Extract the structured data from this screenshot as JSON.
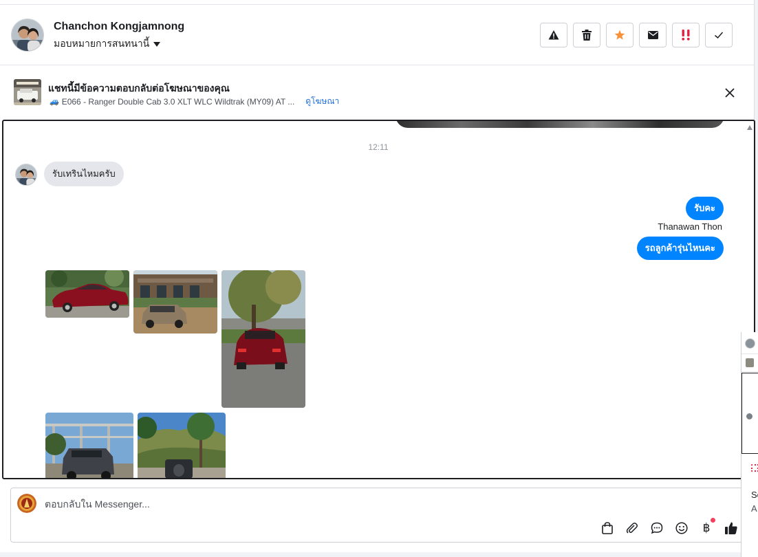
{
  "header": {
    "contact_name": "Chanchon Kongjamnong",
    "assign_label": "มอบหมายการสนทนานี้",
    "actions": [
      {
        "name": "report-spam-button",
        "icon": "warning-icon"
      },
      {
        "name": "delete-button",
        "icon": "trash-icon"
      },
      {
        "name": "star-button",
        "icon": "star-icon",
        "color": "#f7923b"
      },
      {
        "name": "mark-unread-button",
        "icon": "envelope-icon"
      },
      {
        "name": "follow-up-button",
        "icon": "exclamation-icon",
        "color": "#e41e3f"
      },
      {
        "name": "mark-done-button",
        "icon": "check-icon"
      }
    ]
  },
  "banner": {
    "title": "แชทนี้มีข้อความตอบกลับต่อโฆษณาของคุณ",
    "ad_text": "E066 - Ranger Double Cab 3.0 XLT WLC Wildtrak (MY09) AT ...",
    "ad_emoji": "🚙",
    "view_ad_link": "ดูโฆษณา"
  },
  "conversation": {
    "timestamp": "12:11",
    "incoming_message": "รับเทรินไหมครับ",
    "outgoing_1": "รับคะ",
    "sender_name": "Thanawan Thon",
    "outgoing_2": "รถลูกค้ารุ่นไหนคะ"
  },
  "composer": {
    "placeholder": "ตอบกลับใน Messenger...",
    "baht_symbol": "฿"
  },
  "side_window": {
    "text_1": "So",
    "text_2": "A"
  },
  "colors": {
    "accent": "#0084ff",
    "link": "#216fdb",
    "bubble_in": "#e4e6eb"
  }
}
